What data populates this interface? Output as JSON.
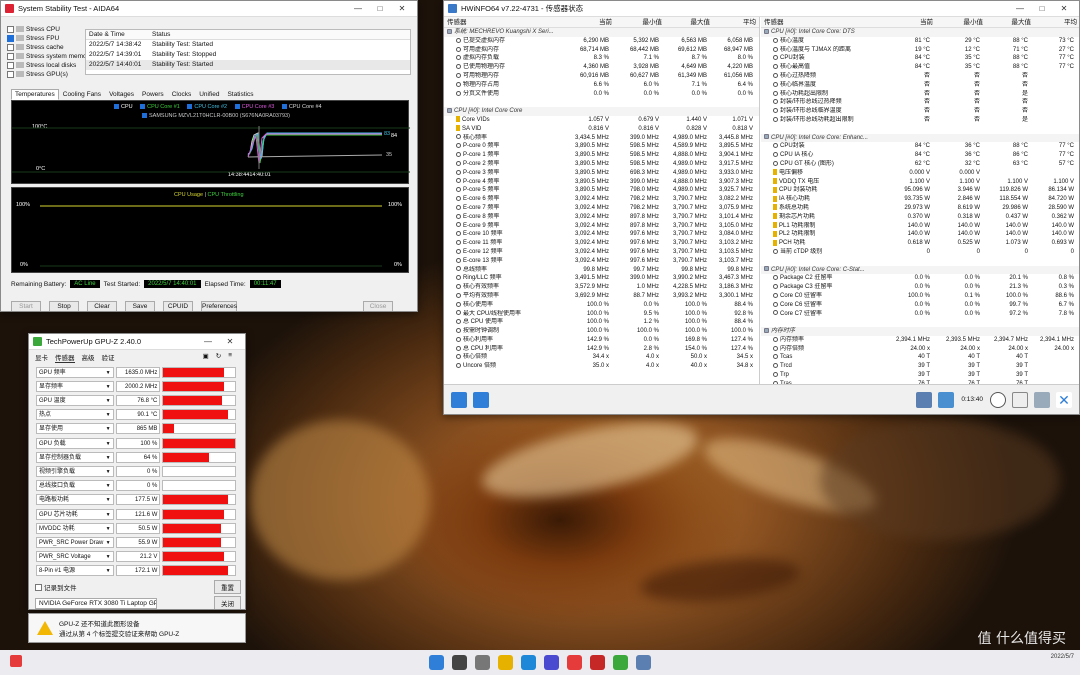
{
  "aida": {
    "title": "System Stability Test - AIDA64",
    "options": [
      {
        "label": "Stress CPU",
        "checked": false
      },
      {
        "label": "Stress FPU",
        "checked": true
      },
      {
        "label": "Stress cache",
        "checked": false
      },
      {
        "label": "Stress system memory",
        "checked": false
      },
      {
        "label": "Stress local disks",
        "checked": false
      },
      {
        "label": "Stress GPU(s)",
        "checked": false
      }
    ],
    "log_headers": [
      "Date & Time",
      "Status"
    ],
    "log": [
      {
        "time": "2022/5/7 14:38:42",
        "status": "Stability Test: Started"
      },
      {
        "time": "2022/5/7 14:39:01",
        "status": "Stability Test: Stopped"
      },
      {
        "time": "2022/5/7 14:40:01",
        "status": "Stability Test: Started"
      }
    ],
    "tabs": [
      "Temperatures",
      "Cooling Fans",
      "Voltages",
      "Powers",
      "Clocks",
      "Unified",
      "Statistics"
    ],
    "legend1": [
      "CPU",
      "CPU Core #1",
      "CPU Core #2",
      "CPU Core #3",
      "CPU Core #4"
    ],
    "legend1b": "SAMSUNG MZVL21T0HCLR-00B00 (S676NA0RA03793)",
    "g1_top": "100°C",
    "g1_bottom": "0°C",
    "g1_time": "14:38:4414:40:01",
    "g1_right_top": "84",
    "g1_right_top2": "83",
    "g1_right_mid": "35",
    "legend2a": "CPU Usage",
    "legend2b": "CPU Throttling",
    "g2_top_l": "100%",
    "g2_bot_l": "0%",
    "g2_top_r": "100%",
    "g2_bot_r": "0%",
    "remaining_label": "Remaining Battery:",
    "remaining_val": "AC Line",
    "started_label": "Test Started:",
    "started_val": "2022/5/7 14:40:01",
    "elapsed_label": "Elapsed Time:",
    "elapsed_val": "00:11:47",
    "buttons": [
      "Start",
      "Stop",
      "Clear",
      "Save",
      "CPUID",
      "Preferences",
      "Close"
    ]
  },
  "hw": {
    "title": "HWiNFO64 v7.22-4731 - 传感器状态",
    "headers": [
      "传感器",
      "当前",
      "最小值",
      "最大值",
      "平均"
    ],
    "left_rows": [
      {
        "t": "grp",
        "n": "系统: MECHREVO Kuangshi X Seri..."
      },
      {
        "n": "已提交虚拟内存",
        "c": "6,290 MB",
        "mi": "5,392 MB",
        "ma": "6,563 MB",
        "a": "6,058 MB"
      },
      {
        "n": "可用虚拟内存",
        "c": "68,714 MB",
        "mi": "68,442 MB",
        "ma": "69,612 MB",
        "a": "68,947 MB"
      },
      {
        "n": "虚拟内存负载",
        "c": "8.3 %",
        "mi": "7.1 %",
        "ma": "8.7 %",
        "a": "8.0 %"
      },
      {
        "n": "已使用物理内存",
        "c": "4,360 MB",
        "mi": "3,928 MB",
        "ma": "4,649 MB",
        "a": "4,220 MB"
      },
      {
        "n": "可用物理内存",
        "c": "60,916 MB",
        "mi": "60,627 MB",
        "ma": "61,349 MB",
        "a": "61,056 MB"
      },
      {
        "n": "物理内存占用",
        "c": "6.6 %",
        "mi": "6.0 %",
        "ma": "7.1 %",
        "a": "6.4 %"
      },
      {
        "n": "分页文件使用",
        "c": "0.0 %",
        "mi": "0.0 %",
        "ma": "0.0 %",
        "a": "0.0 %"
      },
      {
        "t": "blank",
        "n": ""
      },
      {
        "t": "grp",
        "n": "CPU [#0]: Intel Core Core"
      },
      {
        "n": "Core VIDs",
        "c": "1.057 V",
        "mi": "0.679 V",
        "ma": "1.440 V",
        "a": "1.071 V"
      },
      {
        "n": "SA VID",
        "c": "0.816 V",
        "mi": "0.816 V",
        "ma": "0.828 V",
        "a": "0.818 V"
      },
      {
        "n": "核心频率",
        "c": "3,434.5 MHz",
        "mi": "399.0 MHz",
        "ma": "4,989.0 MHz",
        "a": "3,445.8 MHz"
      },
      {
        "n": "P-core 0 频率",
        "c": "3,890.5 MHz",
        "mi": "598.5 MHz",
        "ma": "4,589.9 MHz",
        "a": "3,895.5 MHz"
      },
      {
        "n": "P-core 1 频率",
        "c": "3,890.5 MHz",
        "mi": "598.5 MHz",
        "ma": "4,888.0 MHz",
        "a": "3,904.1 MHz"
      },
      {
        "n": "P-core 2 频率",
        "c": "3,890.5 MHz",
        "mi": "598.5 MHz",
        "ma": "4,989.0 MHz",
        "a": "3,917.5 MHz"
      },
      {
        "n": "P-core 3 频率",
        "c": "3,890.5 MHz",
        "mi": "698.3 MHz",
        "ma": "4,989.0 MHz",
        "a": "3,933.0 MHz"
      },
      {
        "n": "P-core 4 频率",
        "c": "3,890.5 MHz",
        "mi": "399.0 MHz",
        "ma": "4,888.0 MHz",
        "a": "3,907.3 MHz"
      },
      {
        "n": "P-core 5 频率",
        "c": "3,890.5 MHz",
        "mi": "798.0 MHz",
        "ma": "4,989.0 MHz",
        "a": "3,925.7 MHz"
      },
      {
        "n": "E-core 6 频率",
        "c": "3,092.4 MHz",
        "mi": "798.2 MHz",
        "ma": "3,790.7 MHz",
        "a": "3,082.2 MHz"
      },
      {
        "n": "E-core 7 频率",
        "c": "3,092.4 MHz",
        "mi": "798.2 MHz",
        "ma": "3,790.7 MHz",
        "a": "3,075.9 MHz"
      },
      {
        "n": "E-core 8 频率",
        "c": "3,092.4 MHz",
        "mi": "897.8 MHz",
        "ma": "3,790.7 MHz",
        "a": "3,101.4 MHz"
      },
      {
        "n": "E-core 9 频率",
        "c": "3,092.4 MHz",
        "mi": "897.8 MHz",
        "ma": "3,790.7 MHz",
        "a": "3,105.0 MHz"
      },
      {
        "n": "E-core 10 频率",
        "c": "3,092.4 MHz",
        "mi": "997.6 MHz",
        "ma": "3,790.7 MHz",
        "a": "3,084.0 MHz"
      },
      {
        "n": "E-core 11 频率",
        "c": "3,092.4 MHz",
        "mi": "997.6 MHz",
        "ma": "3,790.7 MHz",
        "a": "3,103.2 MHz"
      },
      {
        "n": "E-core 12 频率",
        "c": "3,092.4 MHz",
        "mi": "997.6 MHz",
        "ma": "3,790.7 MHz",
        "a": "3,103.5 MHz"
      },
      {
        "n": "E-core 13 频率",
        "c": "3,092.4 MHz",
        "mi": "997.6 MHz",
        "ma": "3,790.7 MHz",
        "a": "3,103.7 MHz"
      },
      {
        "n": "总线频率",
        "c": "99.8 MHz",
        "mi": "99.7 MHz",
        "ma": "99.8 MHz",
        "a": "99.8 MHz"
      },
      {
        "n": "Ring/LLC 频率",
        "c": "3,491.5 MHz",
        "mi": "399.0 MHz",
        "ma": "3,990.2 MHz",
        "a": "3,467.3 MHz"
      },
      {
        "n": "核心有效频率",
        "c": "3,572.9 MHz",
        "mi": "1.0 MHz",
        "ma": "4,228.5 MHz",
        "a": "3,186.3 MHz"
      },
      {
        "n": "平均有效频率",
        "c": "3,692.9 MHz",
        "mi": "88.7 MHz",
        "ma": "3,993.2 MHz",
        "a": "3,300.1 MHz"
      },
      {
        "n": "核心使用率",
        "c": "100.0 %",
        "mi": "0.0 %",
        "ma": "100.0 %",
        "a": "88.4 %"
      },
      {
        "n": "最大 CPU/线程使用率",
        "c": "100.0 %",
        "mi": "9.5 %",
        "ma": "100.0 %",
        "a": "92.8 %"
      },
      {
        "n": "总 CPU 使用率",
        "c": "100.0 %",
        "mi": "1.2 %",
        "ma": "100.0 %",
        "a": "88.4 %"
      },
      {
        "n": "按需时钟调制",
        "c": "100.0 %",
        "mi": "100.0 %",
        "ma": "100.0 %",
        "a": "100.0 %"
      },
      {
        "n": "核心利用率",
        "c": "142.9 %",
        "mi": "0.0 %",
        "ma": "169.8 %",
        "a": "127.4 %"
      },
      {
        "n": "总 CPU 利用率",
        "c": "142.9 %",
        "mi": "2.8 %",
        "ma": "154.0 %",
        "a": "127.4 %"
      },
      {
        "n": "核心倍频",
        "c": "34.4 x",
        "mi": "4.0 x",
        "ma": "50.0 x",
        "a": "34.5 x"
      },
      {
        "n": "Uncore 倍频",
        "c": "35.0 x",
        "mi": "4.0 x",
        "ma": "40.0 x",
        "a": "34.8 x"
      }
    ],
    "right_rows": [
      {
        "t": "grp",
        "n": "CPU [#0]: Intel Core Core: DTS"
      },
      {
        "n": "核心温度",
        "c": "81 °C",
        "mi": "29 °C",
        "ma": "88 °C",
        "a": "73 °C"
      },
      {
        "n": "核心温度与 TJMAX 的距离",
        "c": "19 °C",
        "mi": "12 °C",
        "ma": "71 °C",
        "a": "27 °C"
      },
      {
        "n": "CPU封装",
        "c": "84 °C",
        "mi": "35 °C",
        "ma": "88 °C",
        "a": "77 °C"
      },
      {
        "n": "核心最高值",
        "c": "84 °C",
        "mi": "35 °C",
        "ma": "88 °C",
        "a": "77 °C"
      },
      {
        "n": "核心过热降频",
        "c": "否",
        "mi": "否",
        "ma": "否",
        "a": ""
      },
      {
        "n": "核心临界温度",
        "c": "否",
        "mi": "否",
        "ma": "否",
        "a": ""
      },
      {
        "n": "核心功耗超出限制",
        "c": "否",
        "mi": "否",
        "ma": "是",
        "a": ""
      },
      {
        "n": "封装/环形总线过热降频",
        "c": "否",
        "mi": "否",
        "ma": "否",
        "a": ""
      },
      {
        "n": "封装/环形总线临界温度",
        "c": "否",
        "mi": "否",
        "ma": "否",
        "a": ""
      },
      {
        "n": "封装/环形总线功耗超出限制",
        "c": "否",
        "mi": "否",
        "ma": "是",
        "a": ""
      },
      {
        "t": "blank",
        "n": ""
      },
      {
        "t": "grp",
        "n": "CPU [#0]: Intel Core Core: Enhanc..."
      },
      {
        "n": "CPU封装",
        "c": "84 °C",
        "mi": "36 °C",
        "ma": "88 °C",
        "a": "77 °C"
      },
      {
        "n": "CPU IA 核心",
        "c": "84 °C",
        "mi": "36 °C",
        "ma": "86 °C",
        "a": "77 °C"
      },
      {
        "n": "CPU GT 核心 (图形)",
        "c": "62 °C",
        "mi": "32 °C",
        "ma": "63 °C",
        "a": "57 °C"
      },
      {
        "n": "电压偏移",
        "c": "0.000 V",
        "mi": "0.000 V",
        "ma": "",
        "a": ""
      },
      {
        "n": "VDDQ TX 电压",
        "c": "1.100 V",
        "mi": "1.100 V",
        "ma": "1.100 V",
        "a": "1.100 V"
      },
      {
        "n": "CPU 封装功耗",
        "c": "95.096 W",
        "mi": "3.946 W",
        "ma": "119.826 W",
        "a": "86.134 W"
      },
      {
        "n": "IA 核心功耗",
        "c": "93.735 W",
        "mi": "2.846 W",
        "ma": "118.554 W",
        "a": "84.720 W"
      },
      {
        "n": "系统总功耗",
        "c": "29.973 W",
        "mi": "8.619 W",
        "ma": "29.986 W",
        "a": "28.590 W"
      },
      {
        "n": "剩余芯片功耗",
        "c": "0.370 W",
        "mi": "0.318 W",
        "ma": "0.437 W",
        "a": "0.362 W"
      },
      {
        "n": "PL1 功耗限制",
        "c": "140.0 W",
        "mi": "140.0 W",
        "ma": "140.0 W",
        "a": "140.0 W"
      },
      {
        "n": "PL2 功耗限制",
        "c": "140.0 W",
        "mi": "140.0 W",
        "ma": "140.0 W",
        "a": "140.0 W"
      },
      {
        "n": "PCH 功耗",
        "c": "0.618 W",
        "mi": "0.525 W",
        "ma": "1.073 W",
        "a": "0.693 W"
      },
      {
        "n": "当前 cTDP 级别",
        "c": "0",
        "mi": "0",
        "ma": "0",
        "a": "0"
      },
      {
        "t": "blank",
        "n": ""
      },
      {
        "t": "grp",
        "n": "CPU [#0]: Intel Core Core: C-Stat..."
      },
      {
        "n": "Package C2 驻留率",
        "c": "0.0 %",
        "mi": "0.0 %",
        "ma": "20.1 %",
        "a": "0.8 %"
      },
      {
        "n": "Package C3 驻留率",
        "c": "0.0 %",
        "mi": "0.0 %",
        "ma": "21.3 %",
        "a": "0.3 %"
      },
      {
        "n": "Core C0 驻留率",
        "c": "100.0 %",
        "mi": "0.1 %",
        "ma": "100.0 %",
        "a": "88.6 %"
      },
      {
        "n": "Core C6 驻留率",
        "c": "0.0 %",
        "mi": "0.0 %",
        "ma": "99.7 %",
        "a": "6.7 %"
      },
      {
        "n": "Core C7 驻留率",
        "c": "0.0 %",
        "mi": "0.0 %",
        "ma": "97.2 %",
        "a": "7.8 %"
      },
      {
        "t": "blank",
        "n": ""
      },
      {
        "t": "grp",
        "n": "内存时序"
      },
      {
        "n": "内存频率",
        "c": "2,394.1 MHz",
        "mi": "2,393.5 MHz",
        "ma": "2,394.7 MHz",
        "a": "2,394.1 MHz"
      },
      {
        "n": "内存倍频",
        "c": "24.00 x",
        "mi": "24.00 x",
        "ma": "24.00 x",
        "a": "24.00 x"
      },
      {
        "n": "Tcas",
        "c": "40 T",
        "mi": "40 T",
        "ma": "40 T",
        "a": ""
      },
      {
        "n": "Trcd",
        "c": "39 T",
        "mi": "39 T",
        "ma": "39 T",
        "a": ""
      },
      {
        "n": "Trp",
        "c": "39 T",
        "mi": "39 T",
        "ma": "39 T",
        "a": ""
      },
      {
        "n": "Tras",
        "c": "76 T",
        "mi": "76 T",
        "ma": "76 T",
        "a": ""
      }
    ],
    "timer": "0:13:40"
  },
  "gpuz": {
    "title": "TechPowerUp GPU-Z 2.40.0",
    "menu": [
      "显卡",
      "传感器",
      "高级",
      "验证"
    ],
    "rows": [
      {
        "label": "GPU 频率",
        "value": "1635.0 MHz",
        "fill": 0.85
      },
      {
        "label": "显存频率",
        "value": "2000.2 MHz",
        "fill": 0.85
      },
      {
        "label": "GPU 温度",
        "value": "76.8 °C",
        "fill": 0.82
      },
      {
        "label": "热点",
        "value": "90.1 °C",
        "fill": 0.9
      },
      {
        "label": "显存使用",
        "value": "865 MB",
        "fill": 0.15
      },
      {
        "label": "GPU 负载",
        "value": "100 %",
        "fill": 1.0
      },
      {
        "label": "显存控制器负载",
        "value": "64 %",
        "fill": 0.64
      },
      {
        "label": "视频引擎负载",
        "value": "0 %",
        "fill": 0
      },
      {
        "label": "总线接口负载",
        "value": "0 %",
        "fill": 0
      },
      {
        "label": "电路板功耗",
        "value": "177.5 W",
        "fill": 0.9
      },
      {
        "label": "GPU 芯片功耗",
        "value": "121.6 W",
        "fill": 0.85
      },
      {
        "label": "MVDDC 功耗",
        "value": "50.5 W",
        "fill": 0.8
      },
      {
        "label": "PWR_SRC Power Draw",
        "value": "55.9 W",
        "fill": 0.8
      },
      {
        "label": "PWR_SRC Voltage",
        "value": "21.2 V",
        "fill": 0.85
      },
      {
        "label": "8-Pin #1 电源",
        "value": "172.1 W",
        "fill": 0.9
      }
    ],
    "log_label": "记录到文件",
    "reset_label": "重置",
    "gpu_select": "NVIDIA GeForce RTX 3080 Ti Laptop GPU",
    "close_label": "关闭"
  },
  "notify": {
    "line1": "GPU-Z 还不知道此图形设备",
    "line2": "通过从第 4 个标签提交验证来帮助 GPU-Z"
  },
  "taskbar": {
    "date": "2022/5/7"
  },
  "watermark": "值 什么值得买"
}
